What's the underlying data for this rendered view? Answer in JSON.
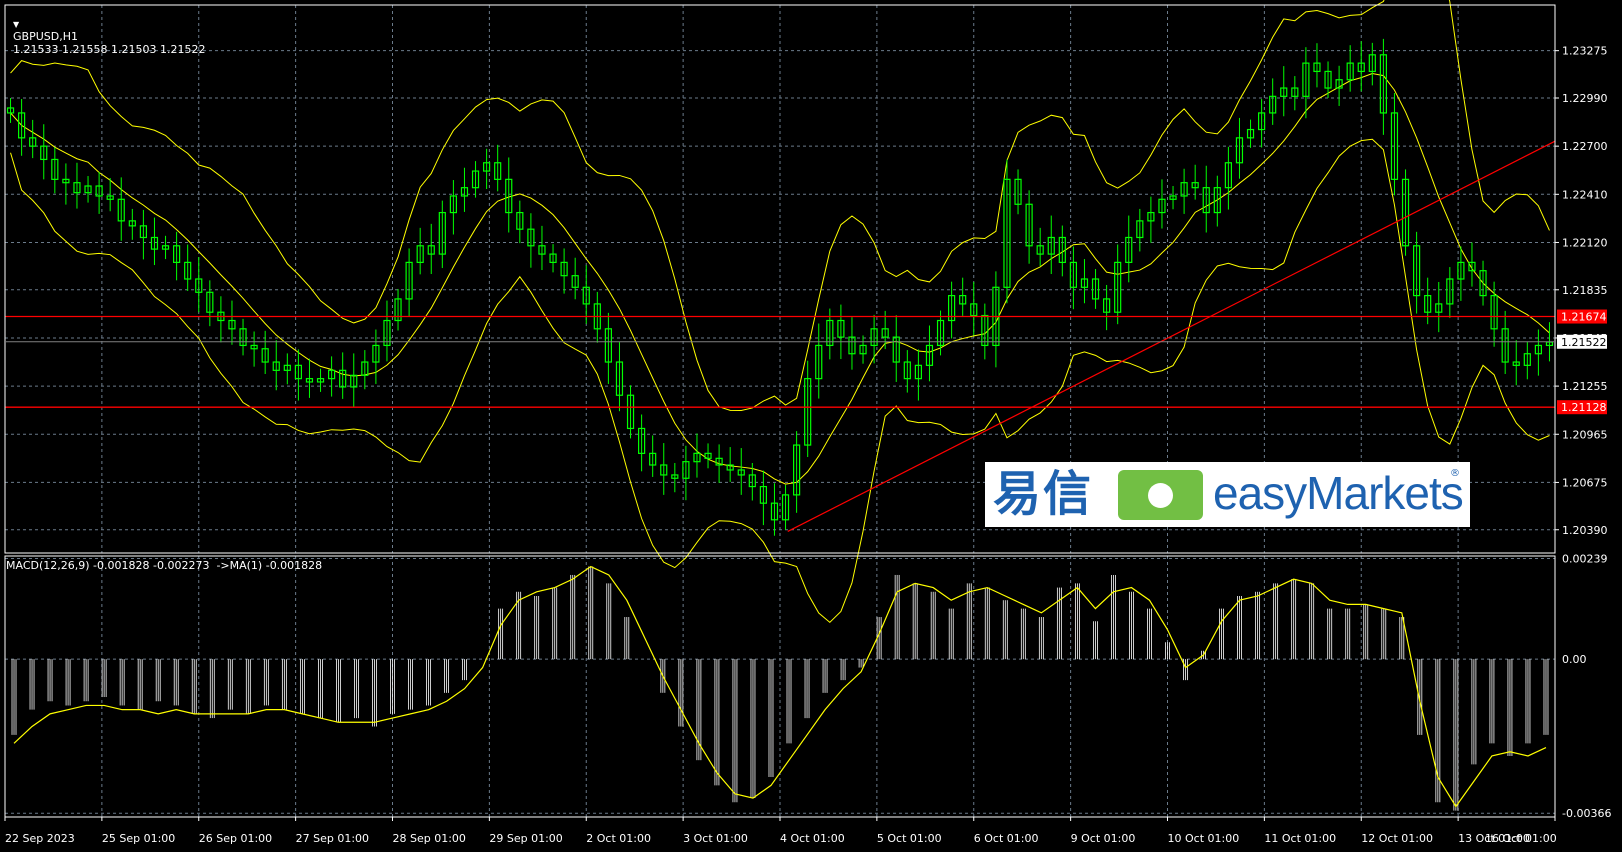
{
  "header": {
    "collapse_icon": "triangle-down-icon",
    "symbol": "GBPUSD,H1",
    "ohlc": "1.21533 1.21558 1.21503 1.21522"
  },
  "macd_header": "MACD(12,26,9) -0.001828 -0.002273  ->MA(1) -0.001828",
  "logo": {
    "cn": "易信",
    "en": "easyMarkets",
    "reg": "®"
  },
  "colors": {
    "background": "#000000",
    "candle": "#00ff00",
    "bands": "#ffff00",
    "grid": "#6b7b8b",
    "level": "#ff0000",
    "trendline": "#ff0000",
    "histogram": "#ffffff",
    "signal": "#ffff00",
    "price_tag_bg": "#ffffff",
    "price_tag_fg": "#000000",
    "level_tag_bg": "#ff0000",
    "level_tag_fg": "#ffffff"
  },
  "chart_data": [
    {
      "type": "candlestick",
      "symbol": "GBPUSD",
      "timeframe": "H1",
      "ylim": [
        1.2025,
        1.2355
      ],
      "price_ticks": [
        "1.23275",
        "1.22990",
        "1.22700",
        "1.22410",
        "1.22120",
        "1.21835",
        "1.21545",
        "1.21255",
        "1.20965",
        "1.20675",
        "1.20390"
      ],
      "current_price": "1.21522",
      "horizontal_levels": [
        {
          "label": "1.21674",
          "value": 1.21674
        },
        {
          "label": "1.21128",
          "value": 1.21128
        }
      ],
      "trendline": [
        [
          0.505,
          1.2038
        ],
        [
          1.0,
          1.2273
        ]
      ],
      "close": [
        1.229,
        1.2275,
        1.227,
        1.2262,
        1.225,
        1.2248,
        1.2242,
        1.2246,
        1.224,
        1.2238,
        1.2225,
        1.2222,
        1.2215,
        1.2208,
        1.221,
        1.22,
        1.219,
        1.2182,
        1.217,
        1.2165,
        1.216,
        1.215,
        1.2148,
        1.214,
        1.2135,
        1.2138,
        1.213,
        1.2128,
        1.213,
        1.2135,
        1.2125,
        1.2132,
        1.214,
        1.215,
        1.2165,
        1.2178,
        1.22,
        1.221,
        1.2205,
        1.223,
        1.224,
        1.2245,
        1.2255,
        1.226,
        1.225,
        1.223,
        1.222,
        1.221,
        1.2205,
        1.22,
        1.2192,
        1.2185,
        1.2175,
        1.216,
        1.214,
        1.212,
        1.21,
        1.2085,
        1.2078,
        1.2072,
        1.207,
        1.208,
        1.2085,
        1.2082,
        1.2078,
        1.2075,
        1.2072,
        1.2065,
        1.2055,
        1.2045,
        1.206,
        1.209,
        1.213,
        1.215,
        1.2165,
        1.2155,
        1.2145,
        1.215,
        1.216,
        1.2155,
        1.214,
        1.213,
        1.2138,
        1.215,
        1.2165,
        1.218,
        1.2175,
        1.2168,
        1.215,
        1.2185,
        1.225,
        1.2235,
        1.221,
        1.2205,
        1.2215,
        1.22,
        1.2185,
        1.219,
        1.2178,
        1.217,
        1.22,
        1.2215,
        1.2225,
        1.223,
        1.2238,
        1.224,
        1.2248,
        1.2245,
        1.223,
        1.2245,
        1.226,
        1.2275,
        1.228,
        1.229,
        1.23,
        1.2305,
        1.23,
        1.232,
        1.2315,
        1.2305,
        1.231,
        1.232,
        1.2315,
        1.2325,
        1.229,
        1.225,
        1.221,
        1.218,
        1.217,
        1.2175,
        1.219,
        1.22,
        1.2195,
        1.218,
        1.216,
        1.214,
        1.2138,
        1.2145,
        1.215,
        1.2152
      ],
      "x_labels": [
        "22 Sep 2023",
        "25 Sep 01:00",
        "26 Sep 01:00",
        "27 Sep 01:00",
        "28 Sep 01:00",
        "29 Sep 01:00",
        "2 Oct 01:00",
        "3 Oct 01:00",
        "4 Oct 01:00",
        "5 Oct 01:00",
        "6 Oct 01:00",
        "9 Oct 01:00",
        "10 Oct 01:00",
        "11 Oct 01:00",
        "12 Oct 01:00",
        "13 Oct 01:00",
        "16 Oct 01:00"
      ],
      "indicators": [
        "Bollinger Bands"
      ]
    },
    {
      "type": "bar",
      "title": "MACD(12,26,9) -0.001828 -0.002273  ->MA(1) -0.001828",
      "ylim": [
        -0.00375,
        0.00245
      ],
      "ticks": [
        "0.00239",
        "0.00",
        "-0.00366"
      ],
      "macd": [
        -0.0018,
        -0.0012,
        -0.001,
        -0.0011,
        -0.001,
        -0.0009,
        -0.0011,
        -0.0012,
        -0.001,
        -0.0011,
        -0.0013,
        -0.0014,
        -0.0012,
        -0.0013,
        -0.0011,
        -0.0012,
        -0.0013,
        -0.0014,
        -0.0015,
        -0.0014,
        -0.0016,
        -0.0013,
        -0.0012,
        -0.0011,
        -0.0008,
        -0.0005,
        0.0,
        0.0012,
        0.0016,
        0.0015,
        0.0017,
        0.002,
        0.0022,
        0.0018,
        0.001,
        0.0,
        -0.0008,
        -0.0016,
        -0.0024,
        -0.003,
        -0.0034,
        -0.0033,
        -0.0028,
        -0.002,
        -0.0014,
        -0.0008,
        -0.0005,
        -0.0002,
        0.001,
        0.002,
        0.0018,
        0.0016,
        0.0012,
        0.0018,
        0.0017,
        0.0014,
        0.0012,
        0.001,
        0.0017,
        0.0018,
        0.0009,
        0.002,
        0.0016,
        0.0012,
        0.0004,
        -0.0005,
        0.0002,
        0.0012,
        0.0015,
        0.0016,
        0.0018,
        0.0019,
        0.0018,
        0.0012,
        0.0012,
        0.0013,
        0.0012,
        0.001,
        -0.0018,
        -0.0034,
        -0.0036,
        -0.0025,
        -0.002,
        -0.0023,
        -0.002,
        -0.0018
      ],
      "signal": [
        -0.002,
        -0.0016,
        -0.0013,
        -0.0012,
        -0.0011,
        -0.0011,
        -0.0012,
        -0.0012,
        -0.0013,
        -0.0012,
        -0.0013,
        -0.0013,
        -0.0013,
        -0.0013,
        -0.0012,
        -0.0012,
        -0.0013,
        -0.0014,
        -0.0015,
        -0.0015,
        -0.0015,
        -0.0014,
        -0.0013,
        -0.0012,
        -0.001,
        -0.0007,
        -0.0002,
        0.0008,
        0.0014,
        0.0016,
        0.0017,
        0.0019,
        0.0022,
        0.002,
        0.0014,
        0.0005,
        -0.0004,
        -0.0012,
        -0.002,
        -0.0027,
        -0.0032,
        -0.0033,
        -0.003,
        -0.0024,
        -0.0018,
        -0.0012,
        -0.0007,
        -0.0003,
        0.0006,
        0.0016,
        0.0018,
        0.0017,
        0.0014,
        0.0016,
        0.0017,
        0.0015,
        0.0013,
        0.0011,
        0.0014,
        0.0017,
        0.0012,
        0.0016,
        0.0017,
        0.0014,
        0.0007,
        -0.0002,
        0.0001,
        0.0009,
        0.0014,
        0.0015,
        0.0017,
        0.0019,
        0.0018,
        0.0014,
        0.0013,
        0.0013,
        0.0012,
        0.0011,
        -0.001,
        -0.0028,
        -0.0035,
        -0.0029,
        -0.0023,
        -0.0022,
        -0.0023,
        -0.0021
      ]
    }
  ]
}
